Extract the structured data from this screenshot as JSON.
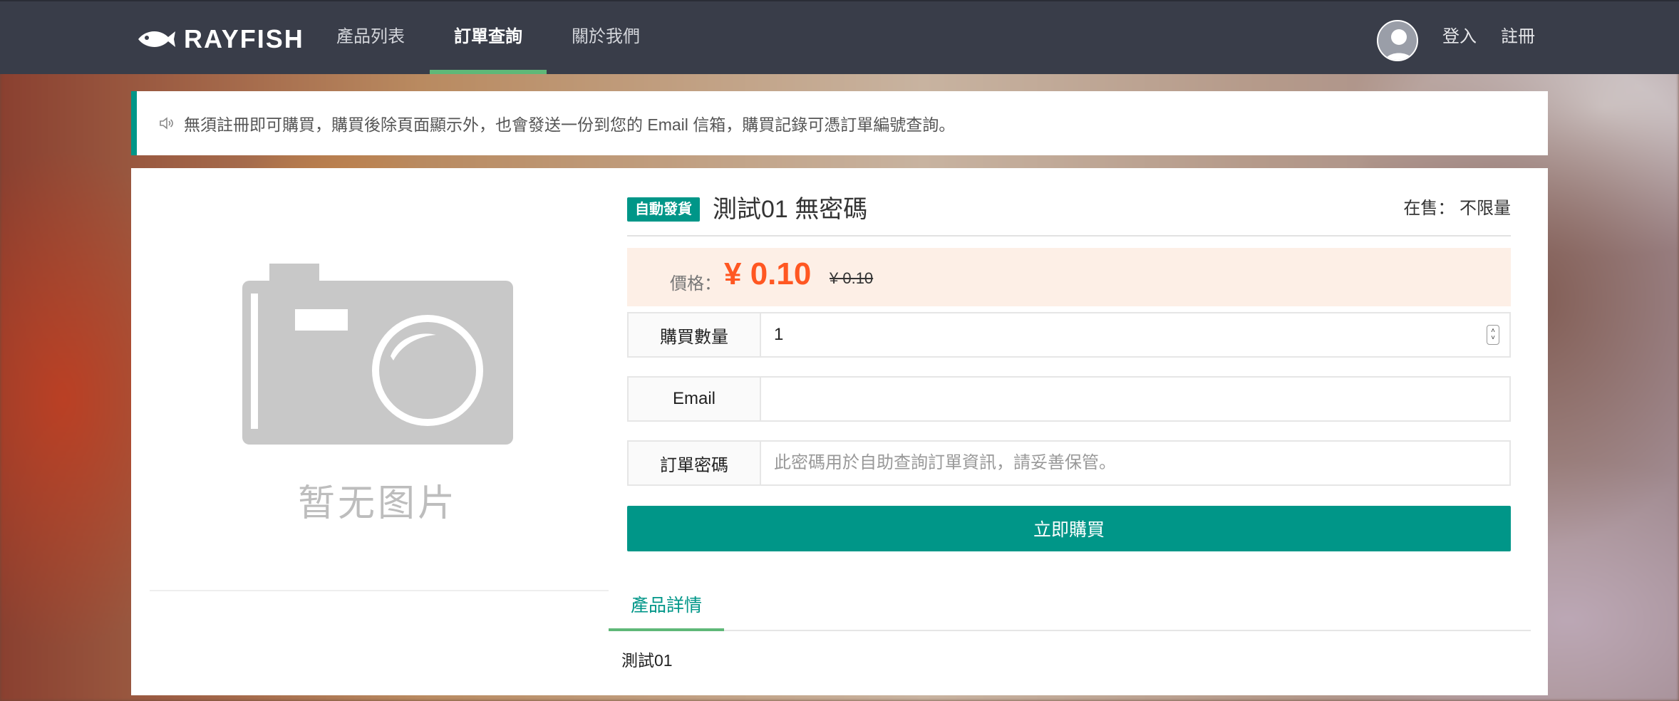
{
  "brand": {
    "name": "RAYFISH",
    "logo_icon": "fish-icon"
  },
  "nav": {
    "items": [
      {
        "label": "產品列表",
        "active": false
      },
      {
        "label": "訂單查詢",
        "active": true
      },
      {
        "label": "關於我們",
        "active": false
      }
    ],
    "login": "登入",
    "register": "註冊",
    "avatar_icon": "user-avatar-icon"
  },
  "notice": {
    "icon": "speaker-icon",
    "text": "無須註冊即可購買，購買後除頁面顯示外，也會發送一份到您的 Email 信箱，購買記錄可憑訂單編號查詢。"
  },
  "product": {
    "badge": "自動發貨",
    "title": "測試01 無密碼",
    "stock_label": "在售：",
    "stock_value": "不限量",
    "image_placeholder_text": "暂无图片",
    "price_label": "價格：",
    "price": "¥ 0.10",
    "original_price": "¥ 0.10"
  },
  "form": {
    "quantity_label": "購買數量",
    "quantity_value": "1",
    "email_label": "Email",
    "email_value": "",
    "password_label": "訂單密碼",
    "password_placeholder": "此密碼用於自助查詢訂單資訊，請妥善保管。",
    "buy_button": "立即購買"
  },
  "details": {
    "tab_label": "產品詳情",
    "content": "測試01"
  },
  "colors": {
    "navbar": "#393d49",
    "accent": "#009688",
    "nav_underline": "#5fb878",
    "price": "#ff5722",
    "price_bg": "#fdefe6"
  }
}
